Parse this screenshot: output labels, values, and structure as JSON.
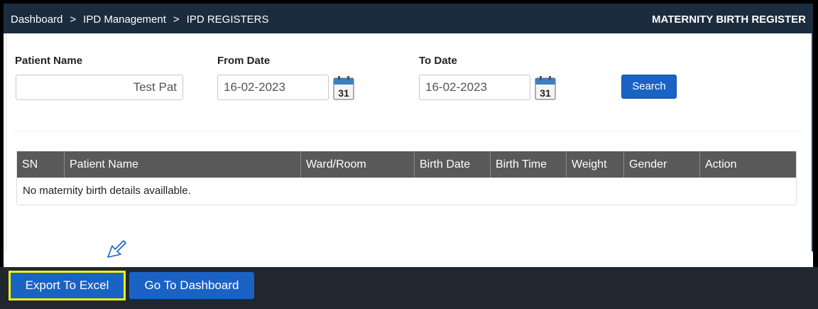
{
  "breadcrumb": {
    "items": [
      "Dashboard",
      "IPD Management",
      "IPD REGISTERS"
    ],
    "separator": ">"
  },
  "page_title": "MATERNITY BIRTH REGISTER",
  "filters": {
    "patient_name_label": "Patient Name",
    "patient_name_value": "Test Pat",
    "from_date_label": "From Date",
    "from_date_value": "16-02-2023",
    "to_date_label": "To Date",
    "to_date_value": "16-02-2023",
    "calendar_day": "31",
    "search_label": "Search"
  },
  "table": {
    "columns": [
      "SN",
      "Patient Name",
      "Ward/Room",
      "Birth Date",
      "Birth Time",
      "Weight",
      "Gender",
      "Action"
    ],
    "empty_message": "No maternity birth details availlable."
  },
  "footer": {
    "export_label": "Export To Excel",
    "dashboard_label": "Go To Dashboard"
  },
  "colors": {
    "topbar": "#1b2c3f",
    "primary_button": "#1a63c4",
    "highlight": "#f2f20a",
    "table_header": "#595959"
  }
}
